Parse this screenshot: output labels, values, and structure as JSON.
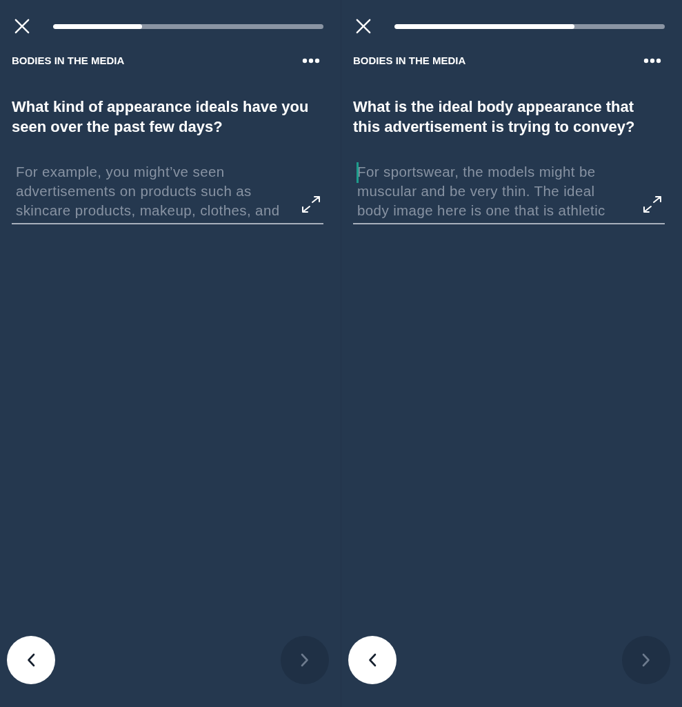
{
  "screens": [
    {
      "progress": {
        "level": 0.33
      },
      "category": "BODIES IN THE MEDIA",
      "question": "What kind of appearance ideals have you seen over the past few days?",
      "answer": {
        "placeholder": "For example, you might’ve seen advertisements on products such as skincare products, makeup, clothes, and",
        "focused": false
      },
      "nav_buttons": [
        {
          "kind": "back",
          "disabled": false
        },
        {
          "kind": "next",
          "disabled": true
        }
      ]
    },
    {
      "progress": {
        "level": 0.665
      },
      "category": "BODIES IN THE MEDIA",
      "question": "What is the ideal body appearance that this advertisement is trying to convey?",
      "answer": {
        "placeholder": "For sportswear, the models might be muscular and be very thin. The ideal body image here is one that is athletic",
        "focused": true
      },
      "nav_buttons": [
        {
          "kind": "back",
          "disabled": false
        },
        {
          "kind": "next",
          "disabled": true
        }
      ]
    }
  ]
}
